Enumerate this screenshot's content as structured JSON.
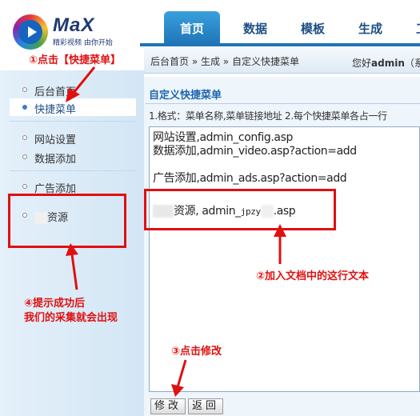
{
  "logo": {
    "text": "MaX",
    "subtitle": "精彩视频 由你开始"
  },
  "topnav": {
    "tabs": [
      {
        "label": "首页",
        "active": true
      },
      {
        "label": "数据",
        "active": false
      },
      {
        "label": "模板",
        "active": false
      },
      {
        "label": "生成",
        "active": false
      },
      {
        "label": "工具",
        "active": false
      }
    ]
  },
  "breadcrumb": "后台首页 » 生成 » 自定义快捷菜单",
  "welcome": {
    "prefix": "您好",
    "user": "admin",
    "suffix": "（系"
  },
  "sidebar": {
    "items": [
      {
        "label": "后台首页"
      },
      {
        "label": "快捷菜单"
      },
      {
        "label": "网站设置"
      },
      {
        "label": "数据添加"
      },
      {
        "label": "广告添加"
      },
      {
        "label": "资源"
      }
    ]
  },
  "panel": {
    "title": "自定义快捷菜单",
    "hint": "1.格式：菜单名称,菜单链接地址    2.每个快捷菜单各占一行",
    "lines": [
      "网站设置,admin_config.asp",
      "数据添加,admin_video.asp?action=add",
      "",
      "广告添加,admin_ads.asp?action=add"
    ],
    "added_line": {
      "name": "资源",
      "url_prefix": "admin_",
      "url_mid": "jpzy",
      "url_suffix": ".asp"
    }
  },
  "buttons": {
    "modify": "修改",
    "back": "返回"
  },
  "annotations": {
    "step1": "①点击【快捷菜单】",
    "step2": "②加入文档中的这行文本",
    "step3": "③点击修改",
    "step4_line1": "④提示成功后",
    "step4_line2": "我们的采集就会出现"
  },
  "colors": {
    "accent": "#1e74b8",
    "annotation": "#e01010",
    "sidebar_bg": "#dbeaf6"
  }
}
